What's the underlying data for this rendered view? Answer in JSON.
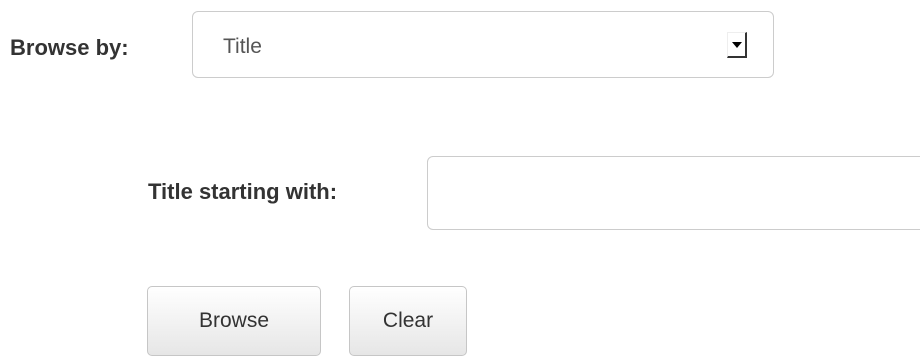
{
  "browse_by": {
    "label": "Browse by:",
    "selected": "Title"
  },
  "title_filter": {
    "label": "Title starting with:",
    "value": "",
    "placeholder": ""
  },
  "buttons": {
    "browse": "Browse",
    "clear": "Clear"
  }
}
